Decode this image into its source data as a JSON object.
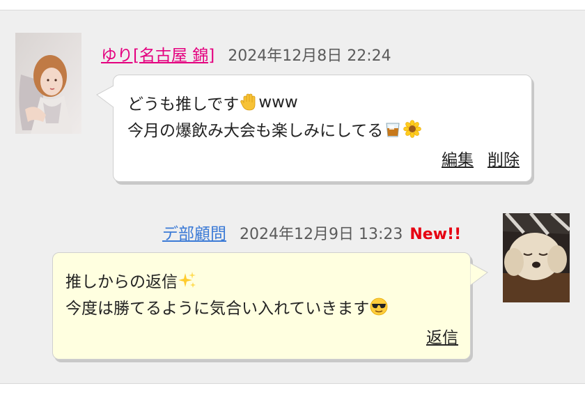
{
  "messages": [
    {
      "author": "ゆり[名古屋 錦]",
      "author_color": "#e4007f",
      "date": "2024年12月8日 22:24",
      "avatar_icon": "woman-photo-avatar",
      "body": {
        "line1_text": "どうも推しです",
        "line1_emoji": "raised-hand-emoji",
        "line1_suffix": "www",
        "line2_text": "今月の爆飲み大会も楽しみにしてる",
        "line2_emojis": [
          "tumbler-glass-emoji",
          "sunflower-emoji"
        ]
      },
      "bubble_color": "#ffffff",
      "actions": [
        "編集",
        "削除"
      ]
    },
    {
      "author": "デ部顧問",
      "author_color": "#3b7ad6",
      "date": "2024年12月9日 13:23",
      "new_badge": "New!!",
      "new_color": "#e60012",
      "avatar_icon": "dog-photo-avatar",
      "body": {
        "line1_text": "推しからの返信",
        "line1_emoji": "sparkles-emoji",
        "line2_text": "今度は勝てるように気合い入れていきます",
        "line2_emoji": "sunglasses-face-emoji"
      },
      "bubble_color": "#ffffe0",
      "actions": [
        "返信"
      ]
    }
  ]
}
